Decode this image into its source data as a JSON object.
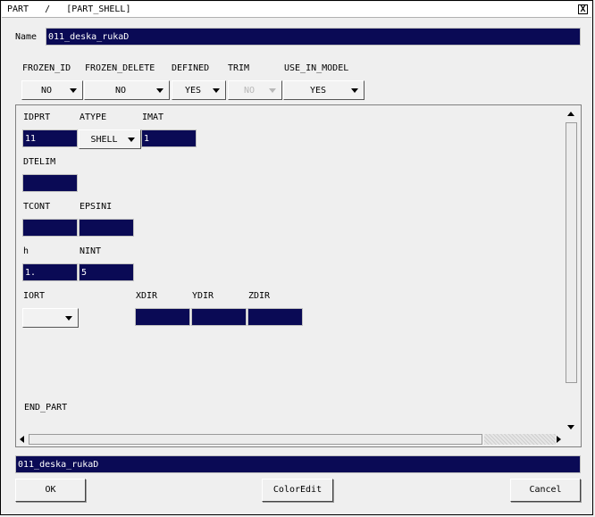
{
  "window": {
    "title": "PART   /   [PART_SHELL]",
    "close_glyph": "X"
  },
  "name": {
    "label": "Name",
    "value": "011_deska_rukaD"
  },
  "flags": {
    "headers": [
      "FROZEN_ID",
      "FROZEN_DELETE",
      "DEFINED",
      "TRIM",
      "USE_IN_MODEL"
    ],
    "values": [
      "NO",
      "NO",
      "YES",
      "NO",
      "YES"
    ]
  },
  "part": {
    "labels": {
      "idprt": "IDPRT",
      "atype": "ATYPE",
      "imat": "IMAT",
      "dtelim": "DTELIM",
      "tcont": "TCONT",
      "epsini": "EPSINI",
      "h": "h",
      "nint": "NINT",
      "iort": "IORT",
      "xdir": "XDIR",
      "ydir": "YDIR",
      "zdir": "ZDIR",
      "end": "END_PART"
    },
    "values": {
      "idprt": "11",
      "atype": "SHELL",
      "imat": "1",
      "dtelim": "",
      "tcont": "",
      "epsini": "",
      "h": "1.",
      "nint": "5",
      "iort": "",
      "xdir": "",
      "ydir": "",
      "zdir": ""
    }
  },
  "status_field": "011_deska_rukaD",
  "buttons": {
    "ok": "OK",
    "coloredit": "ColorEdit",
    "cancel": "Cancel"
  },
  "colors": {
    "field_bg": "#0a0a55",
    "field_text": "#ffffff",
    "window_bg": "#efefef"
  }
}
